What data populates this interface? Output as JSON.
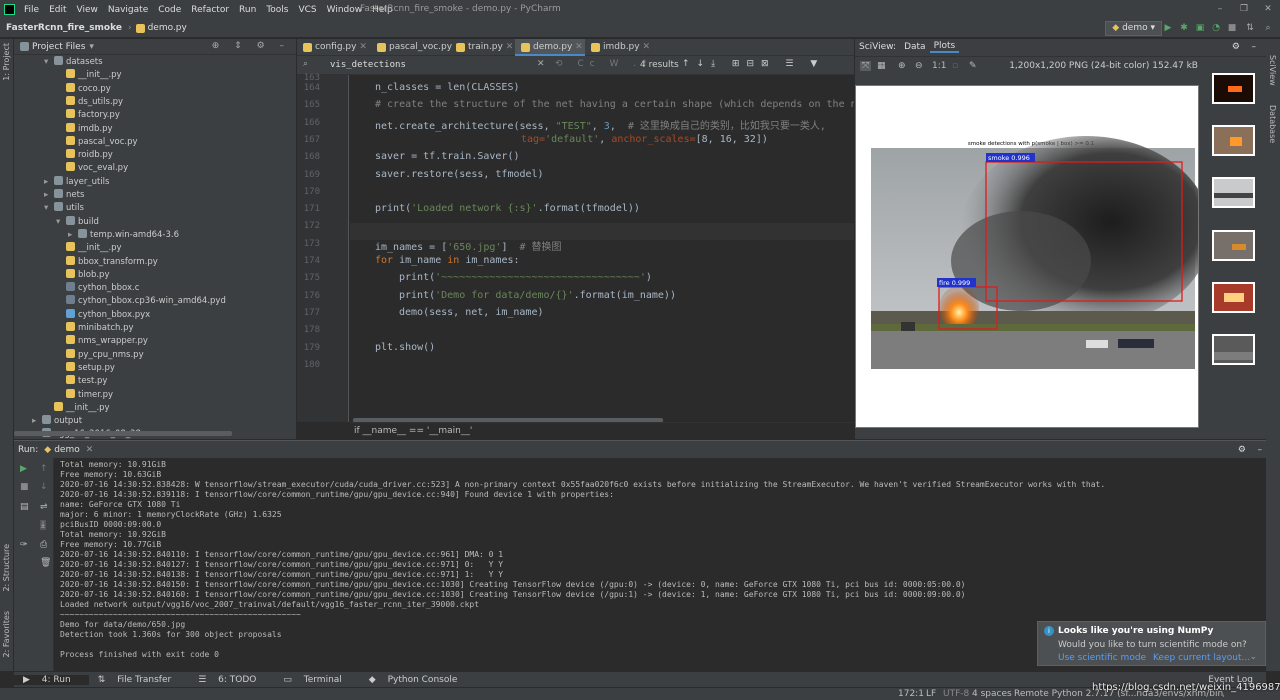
{
  "titlebar": {
    "menu": [
      "File",
      "Edit",
      "View",
      "Navigate",
      "Code",
      "Refactor",
      "Run",
      "Tools",
      "VCS",
      "Window",
      "Help"
    ],
    "window_title": "FasterRcnn_fire_smoke - demo.py - PyCharm"
  },
  "navbar": {
    "project": "FasterRcnn_fire_smoke",
    "file": "demo.py",
    "run_config": "demo"
  },
  "project_panel": {
    "header": "Project Files",
    "rows": [
      {
        "indent": 2,
        "arrow": "▾",
        "icon": "fold",
        "label": "datasets"
      },
      {
        "indent": 3,
        "arrow": "",
        "icon": "py",
        "label": "__init__.py"
      },
      {
        "indent": 3,
        "arrow": "",
        "icon": "py",
        "label": "coco.py"
      },
      {
        "indent": 3,
        "arrow": "",
        "icon": "py",
        "label": "ds_utils.py"
      },
      {
        "indent": 3,
        "arrow": "",
        "icon": "py",
        "label": "factory.py"
      },
      {
        "indent": 3,
        "arrow": "",
        "icon": "py",
        "label": "imdb.py"
      },
      {
        "indent": 3,
        "arrow": "",
        "icon": "py",
        "label": "pascal_voc.py"
      },
      {
        "indent": 3,
        "arrow": "",
        "icon": "py",
        "label": "roidb.py"
      },
      {
        "indent": 3,
        "arrow": "",
        "icon": "py",
        "label": "voc_eval.py"
      },
      {
        "indent": 2,
        "arrow": "▸",
        "icon": "fold",
        "label": "layer_utils"
      },
      {
        "indent": 2,
        "arrow": "▸",
        "icon": "fold",
        "label": "nets"
      },
      {
        "indent": 2,
        "arrow": "▾",
        "icon": "fold",
        "label": "utils"
      },
      {
        "indent": 3,
        "arrow": "▾",
        "icon": "fold",
        "label": "build"
      },
      {
        "indent": 4,
        "arrow": "▸",
        "icon": "fold",
        "label": "temp.win-amd64-3.6"
      },
      {
        "indent": 3,
        "arrow": "",
        "icon": "py",
        "label": "__init__.py"
      },
      {
        "indent": 3,
        "arrow": "",
        "icon": "py",
        "label": "bbox_transform.py"
      },
      {
        "indent": 3,
        "arrow": "",
        "icon": "py",
        "label": "blob.py"
      },
      {
        "indent": 3,
        "arrow": "",
        "icon": "dir",
        "label": "cython_bbox.c"
      },
      {
        "indent": 3,
        "arrow": "",
        "icon": "dir",
        "label": "cython_bbox.cp36-win_amd64.pyd"
      },
      {
        "indent": 3,
        "arrow": "",
        "icon": "pyx",
        "label": "cython_bbox.pyx"
      },
      {
        "indent": 3,
        "arrow": "",
        "icon": "py",
        "label": "minibatch.py"
      },
      {
        "indent": 3,
        "arrow": "",
        "icon": "py",
        "label": "nms_wrapper.py"
      },
      {
        "indent": 3,
        "arrow": "",
        "icon": "py",
        "label": "py_cpu_nms.py"
      },
      {
        "indent": 3,
        "arrow": "",
        "icon": "py",
        "label": "setup.py"
      },
      {
        "indent": 3,
        "arrow": "",
        "icon": "py",
        "label": "test.py"
      },
      {
        "indent": 3,
        "arrow": "",
        "icon": "py",
        "label": "timer.py"
      },
      {
        "indent": 2,
        "arrow": "",
        "icon": "py",
        "label": "__init__.py"
      },
      {
        "indent": 1,
        "arrow": "▸",
        "icon": "fold",
        "label": "output"
      },
      {
        "indent": 1,
        "arrow": "▸",
        "icon": "fold",
        "label": "vgg_16_2016_08_28"
      }
    ]
  },
  "editor": {
    "tabs": [
      "config.py",
      "pascal_voc.py",
      "train.py",
      "demo.py",
      "imdb.py"
    ],
    "active_tab": "demo.py",
    "find_query": "vis_detections",
    "find_results": "4 results",
    "line_numbers": [
      165,
      166,
      167,
      168,
      169,
      170,
      171,
      172,
      173,
      174,
      175,
      176,
      177,
      178,
      179,
      180
    ],
    "first_line_partial": "163",
    "breadcrumb": "if __name__ == '__main__'",
    "lines": {
      "l164a": "n_classes = len(CLASSES)",
      "l165": "# create the structure of the net having a certain shape (which depends on the n",
      "l166a": "net.create_architecture(sess, ",
      "l166b": "\"TEST\"",
      "l166c": ", ",
      "l166d": "3",
      "l166e": ",  ",
      "l166f": "# 这里换成自己的类别，比如我只要一类人,",
      "l167a": "tag=",
      "l167b": "'default'",
      "l167c": ", ",
      "l167d": "anchor_scales=",
      "l167e": "[8, 16, 32])",
      "l168": "saver = tf.train.Saver()",
      "l169": "saver.restore(sess, tfmodel)",
      "l171a": "print(",
      "l171b": "'Loaded network {:s}'",
      "l171c": ".format(tfmodel))",
      "l173a": "im_names = [",
      "l173b": "'650.jpg'",
      "l173c": "]  ",
      "l173d": "# 替换图",
      "l174a": "for ",
      "l174b": "im_name ",
      "l174c": "in ",
      "l174d": "im_names:",
      "l175a": "print(",
      "l175b": "'~~~~~~~~~~~~~~~~~~~~~~~~~~~~~~~~~'",
      "l175c": ")",
      "l176a": "print(",
      "l176b": "'Demo for data/demo/{}'",
      "l176c": ".format(im_name))",
      "l177": "demo(sess, net, im_name)",
      "l179": "plt.show()"
    }
  },
  "sciview": {
    "label": "SciView:",
    "tabs": [
      "Data",
      "Plots"
    ],
    "active_tab": "Plots",
    "zoom_label": "1:1",
    "image_info": "1,200x1,200 PNG (24-bit color) 152.47 kB",
    "plot_title": "smoke detections with p(smoke | box) >= 0.1",
    "box_smoke_label": "smoke 0.996",
    "box_fire_label": "fire 0.999",
    "detections": [
      {
        "class": "smoke",
        "score": 0.996
      },
      {
        "class": "fire",
        "score": 0.999
      }
    ]
  },
  "run_panel": {
    "label": "Run:",
    "config": "demo",
    "console_lines": [
      "Total memory: 10.91GiB",
      "Free memory: 10.63GiB",
      "2020-07-16 14:30:52.838428: W tensorflow/stream_executor/cuda/cuda_driver.cc:523] A non-primary context 0x55faa020f6c0 exists before initializing the StreamExecutor. We haven't verified StreamExecutor works with that.",
      "2020-07-16 14:30:52.839118: I tensorflow/core/common_runtime/gpu/gpu_device.cc:940] Found device 1 with properties:",
      "name: GeForce GTX 1080 Ti",
      "major: 6 minor: 1 memoryClockRate (GHz) 1.6325",
      "pciBusID 0000:09:00.0",
      "Total memory: 10.92GiB",
      "Free memory: 10.77GiB",
      "2020-07-16 14:30:52.840110: I tensorflow/core/common_runtime/gpu/gpu_device.cc:961] DMA: 0 1",
      "2020-07-16 14:30:52.840127: I tensorflow/core/common_runtime/gpu/gpu_device.cc:971] 0:   Y Y",
      "2020-07-16 14:30:52.840138: I tensorflow/core/common_runtime/gpu/gpu_device.cc:971] 1:   Y Y",
      "2020-07-16 14:30:52.840150: I tensorflow/core/common_runtime/gpu/gpu_device.cc:1030] Creating TensorFlow device (/gpu:0) -> (device: 0, name: GeForce GTX 1080 Ti, pci bus id: 0000:05:00.0)",
      "2020-07-16 14:30:52.840160: I tensorflow/core/common_runtime/gpu/gpu_device.cc:1030] Creating TensorFlow device (/gpu:1) -> (device: 1, name: GeForce GTX 1080 Ti, pci bus id: 0000:09:00.0)",
      "Loaded network output/vgg16/voc_2007_trainval/default/vgg16_faster_rcnn_iter_39000.ckpt",
      "~~~~~~~~~~~~~~~~~~~~~~~~~~~~~~~~~~~~~~~~~~~~~~~~~~",
      "Demo for data/demo/650.jpg",
      "Detection took 1.360s for 300 object proposals",
      "",
      "Process finished with exit code 0"
    ]
  },
  "notification": {
    "title": "Looks like you're using NumPy",
    "body": "Would you like to turn scientific mode on?",
    "link1": "Use scientific mode",
    "link2": "Keep current layout..."
  },
  "bottom_tabs": [
    "4: Run",
    "File Transfer",
    "6: TODO",
    "Terminal",
    "Python Console"
  ],
  "event_log": "Event Log",
  "status": {
    "position": "172:1",
    "line_sep": "LF",
    "encoding": "UTF-8",
    "indent": "4 spaces",
    "interpreter": "Remote Python 2.7.17 (sf...nda3/envs/xhm/bin/python)",
    "watermark": "https://blog.csdn.net/weixin_41969873"
  },
  "side_tabs": {
    "project": "1: Project",
    "structure": "2: Structure",
    "favorites": "2: Favorites",
    "sciview": "SciView",
    "database": "Database"
  },
  "colors": {
    "accent": "#4a88c7",
    "bg": "#2b2b2b",
    "panel": "#3c3f41",
    "detect_box": "#e01b1b",
    "label_bg": "#2233cc"
  }
}
